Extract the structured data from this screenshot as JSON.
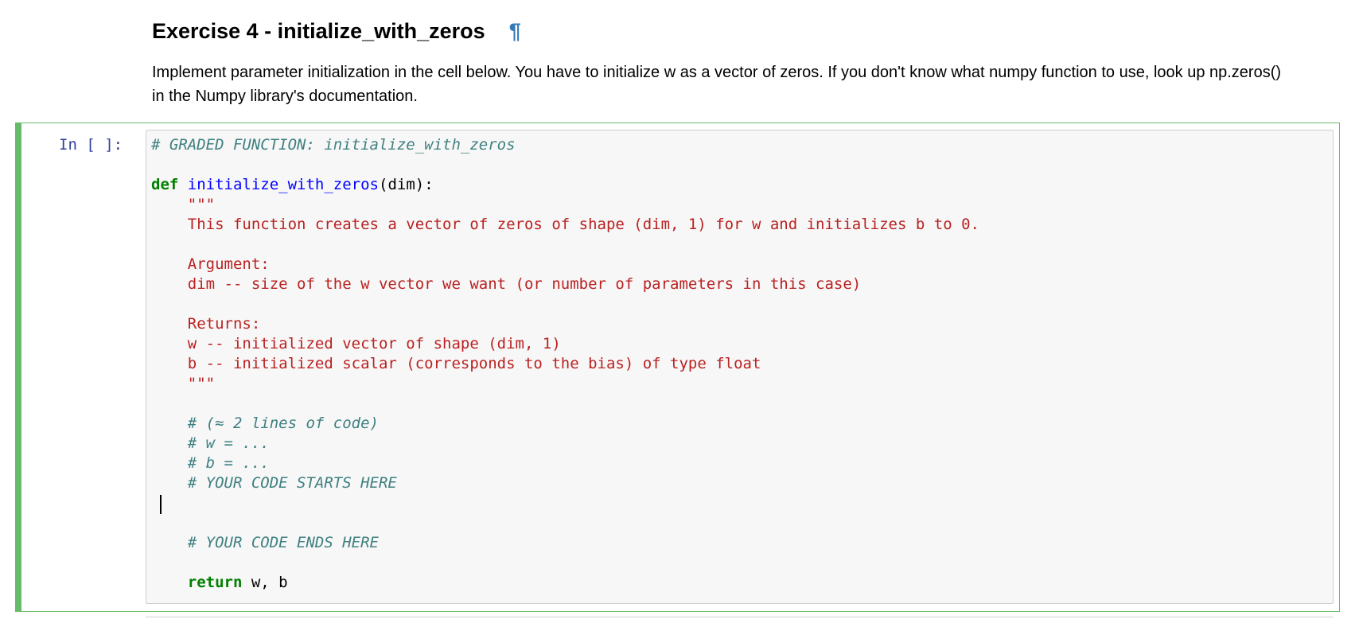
{
  "markdown": {
    "title": "Exercise 4 - initialize_with_zeros",
    "anchor": "¶",
    "description": "Implement parameter initialization in the cell below. You have to initialize w as a vector of zeros. If you don't know what numpy function to use, look up np.zeros() in the Numpy library's documentation."
  },
  "cell": {
    "prompt": "In [ ]:",
    "code": {
      "l1": "# GRADED FUNCTION: initialize_with_zeros",
      "l3_kw": "def",
      "l3_fn": "initialize_with_zeros",
      "l3_rest": "(dim):",
      "l4": "    \"\"\"",
      "l5": "    This function creates a vector of zeros of shape (dim, 1) for w and initializes b to 0.",
      "l7": "    Argument:",
      "l8": "    dim -- size of the w vector we want (or number of parameters in this case)",
      "l10": "    Returns:",
      "l11": "    w -- initialized vector of shape (dim, 1)",
      "l12": "    b -- initialized scalar (corresponds to the bias) of type float",
      "l13": "    \"\"\"",
      "l15": "    # (≈ 2 lines of code)",
      "l16": "    # w = ...",
      "l17": "    # b = ...",
      "l18": "    # YOUR CODE STARTS HERE",
      "l21": "    # YOUR CODE ENDS HERE",
      "l23_indent": "    ",
      "l23_kw": "return",
      "l23_rest": " w, b"
    }
  },
  "colors": {
    "cell_border_active": "#66bb6a",
    "prompt": "#303f9f",
    "comment": "#408080",
    "keyword": "#008000",
    "def_name": "#0000ff",
    "string": "#ba2121",
    "anchor": "#337ab7"
  }
}
